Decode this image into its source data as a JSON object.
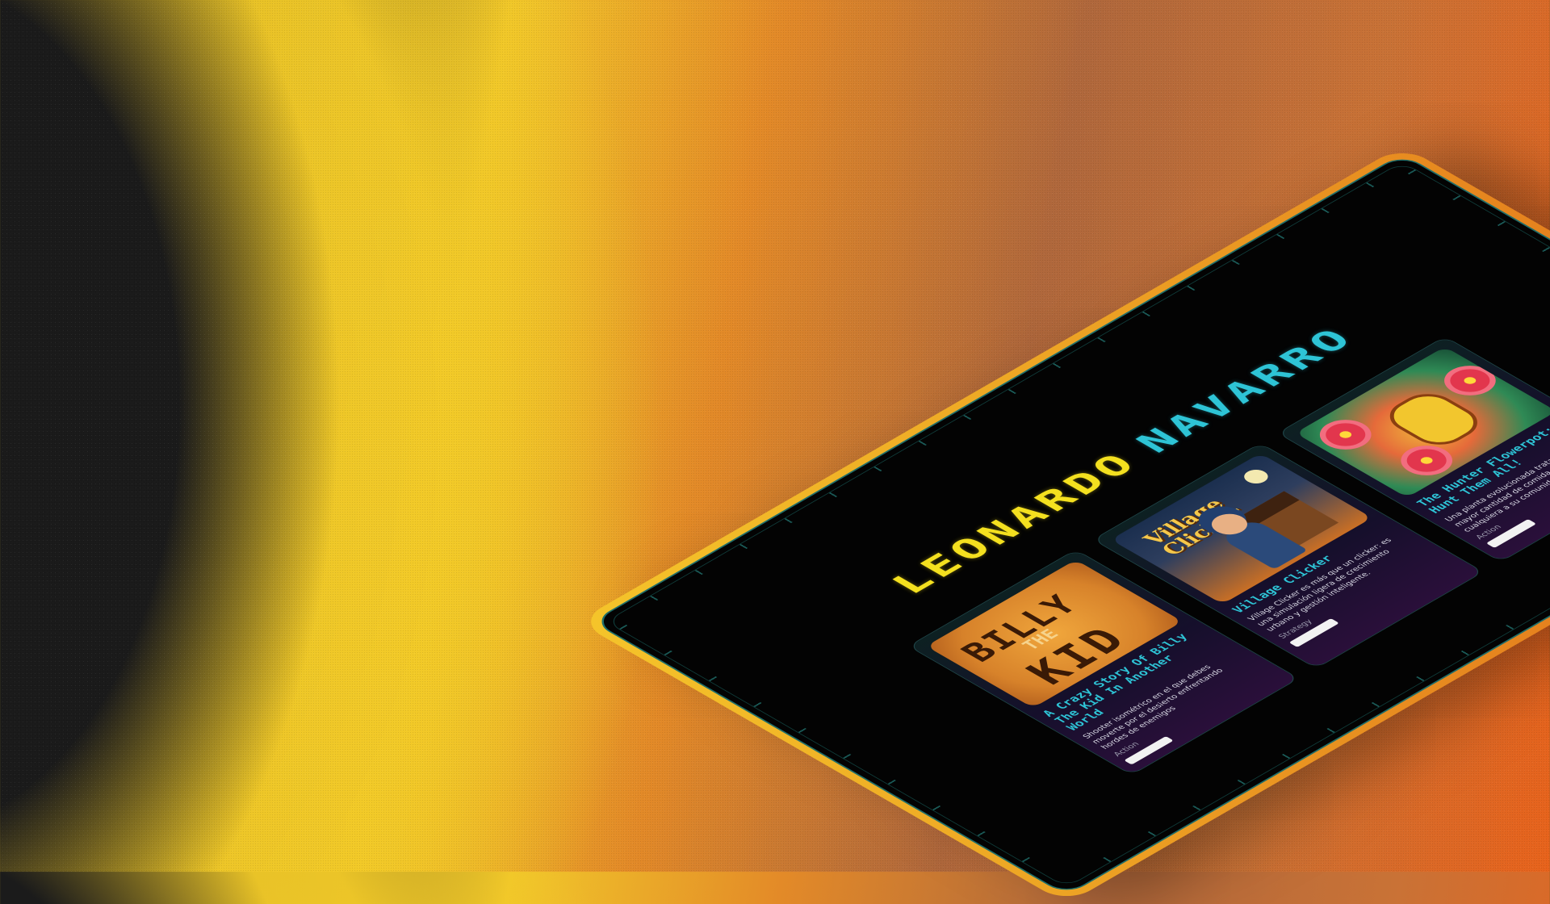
{
  "header": {
    "first_name": "LEONARDO",
    "last_name": "NAVARRO"
  },
  "colors": {
    "first_name": "#f4e01f",
    "last_name": "#2ec4d6",
    "card_title": "#2ec4d6",
    "frame": "#1f6e6a"
  },
  "cards": [
    {
      "thumb_lines": [
        "BILLY",
        "THE",
        "KID"
      ],
      "title": "A Crazy Story Of Billy The Kid In Another World",
      "description": "Shooter isométrico en el que debes moverte por el desierto enfrentando hordes de enemigos",
      "tag": "Action"
    },
    {
      "thumb_lines": [
        "Village",
        "Clicker"
      ],
      "title": "Village Clicker",
      "description": "Village Clicker es más que un clicker: es una simulación ligera de crecimiento urbano y gestión inteligente.",
      "tag": "Strategy"
    },
    {
      "title": "The Hunter Flowerpot: Hunt Them All!",
      "description": "Una planta evolucionada trata de cazar la mayor cantidad de comida y evitar que cualquiera a su comunidad original",
      "tag": "Action"
    }
  ]
}
